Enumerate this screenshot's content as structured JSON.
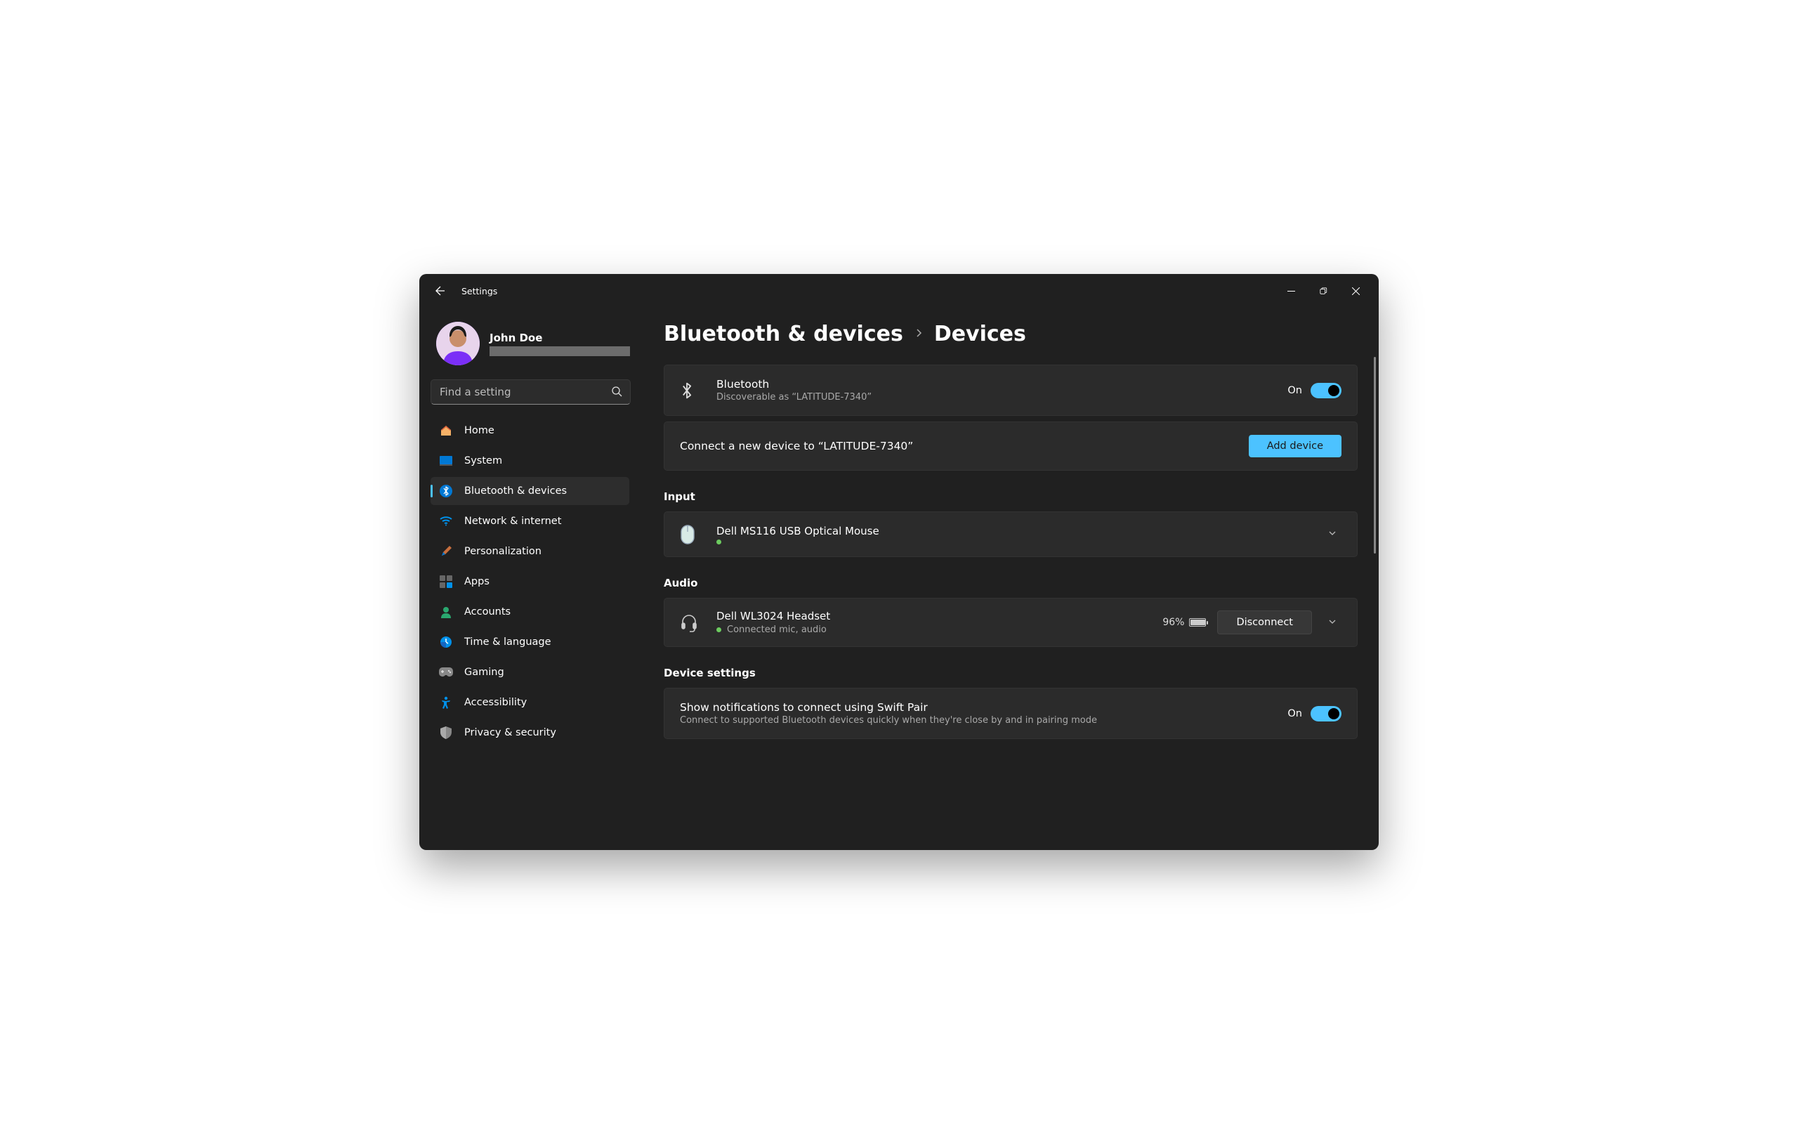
{
  "title": "Settings",
  "user": {
    "name": "John Doe"
  },
  "search": {
    "placeholder": "Find a setting"
  },
  "nav": {
    "items": [
      {
        "label": "Home"
      },
      {
        "label": "System"
      },
      {
        "label": "Bluetooth & devices"
      },
      {
        "label": "Network & internet"
      },
      {
        "label": "Personalization"
      },
      {
        "label": "Apps"
      },
      {
        "label": "Accounts"
      },
      {
        "label": "Time & language"
      },
      {
        "label": "Gaming"
      },
      {
        "label": "Accessibility"
      },
      {
        "label": "Privacy & security"
      }
    ]
  },
  "breadcrumb": {
    "parent": "Bluetooth & devices",
    "current": "Devices"
  },
  "bluetooth": {
    "title": "Bluetooth",
    "subtitle": "Discoverable as “LATITUDE-7340”",
    "state": "On"
  },
  "connect": {
    "text": "Connect a new device to “LATITUDE-7340”",
    "button": "Add device"
  },
  "sections": {
    "input": {
      "heading": "Input",
      "device": {
        "name": "Dell MS116 USB Optical Mouse"
      }
    },
    "audio": {
      "heading": "Audio",
      "device": {
        "name": "Dell WL3024 Headset",
        "status": "Connected mic, audio",
        "battery": "96%",
        "action": "Disconnect"
      }
    },
    "settings": {
      "heading": "Device settings",
      "swift": {
        "title": "Show notifications to connect using Swift Pair",
        "subtitle": "Connect to supported Bluetooth devices quickly when they're close by and in pairing mode",
        "state": "On"
      }
    }
  }
}
